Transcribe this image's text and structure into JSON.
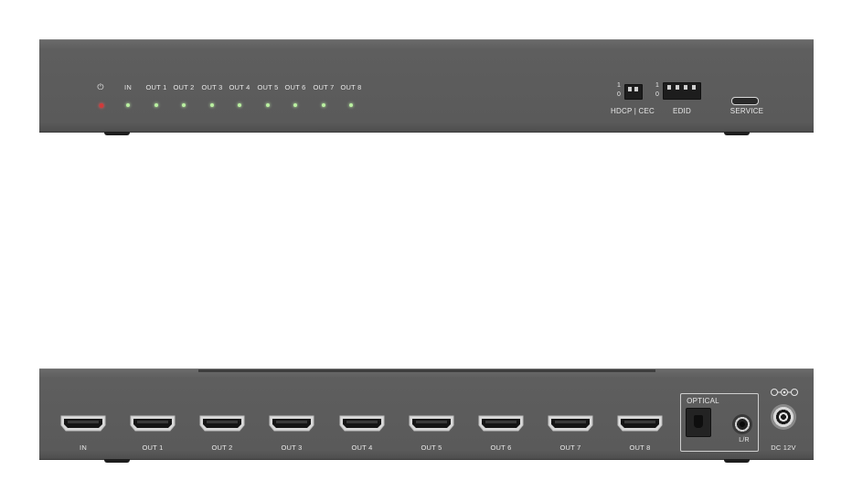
{
  "front_panel": {
    "power_label": "⏻",
    "indicators": [
      "IN",
      "OUT 1",
      "OUT 2",
      "OUT 3",
      "OUT 4",
      "OUT 5",
      "OUT 6",
      "OUT 7",
      "OUT 8"
    ],
    "dip_hdcp": {
      "label": "HDCP | CEC",
      "top": "1",
      "bottom": "0"
    },
    "dip_edid": {
      "label": "EDID",
      "top": "1",
      "bottom": "0"
    },
    "service_label": "SERVICE"
  },
  "rear_panel": {
    "ports": [
      "IN",
      "OUT 1",
      "OUT 2",
      "OUT 3",
      "OUT 4",
      "OUT 5",
      "OUT 6",
      "OUT 7",
      "OUT 8"
    ],
    "optical_label": "OPTICAL",
    "lr_label": "L/R",
    "dc_label": "DC 12V"
  },
  "colors": {
    "panel": "#5c5c5c",
    "led_power": "#d23a3a",
    "led_status": "#b9f0a0"
  }
}
